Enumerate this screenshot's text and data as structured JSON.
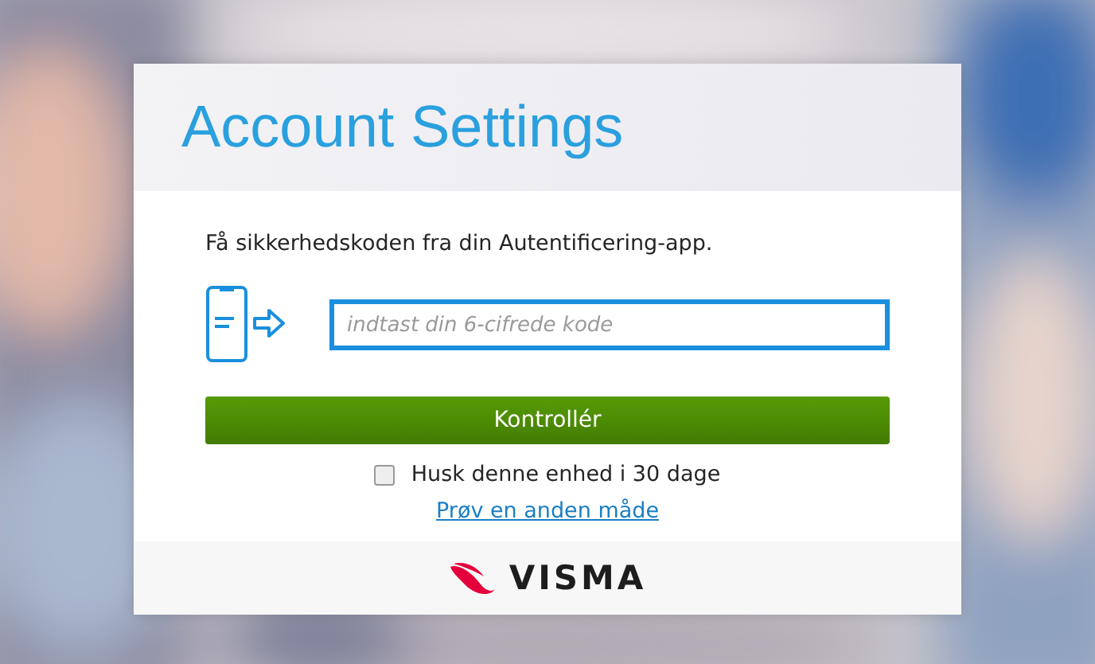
{
  "header": {
    "title": "Account Settings"
  },
  "instruction": "Få sikkerhedskoden fra din Autentificering-app.",
  "code_field": {
    "placeholder": "indtast din 6-cifrede kode"
  },
  "submit_button": "Kontrollér",
  "remember": {
    "label": "Husk denne enhed i 30 dage",
    "checked": false
  },
  "alternative_link": "Prøv en anden måde",
  "footer": {
    "logo_text": "VISMA"
  }
}
